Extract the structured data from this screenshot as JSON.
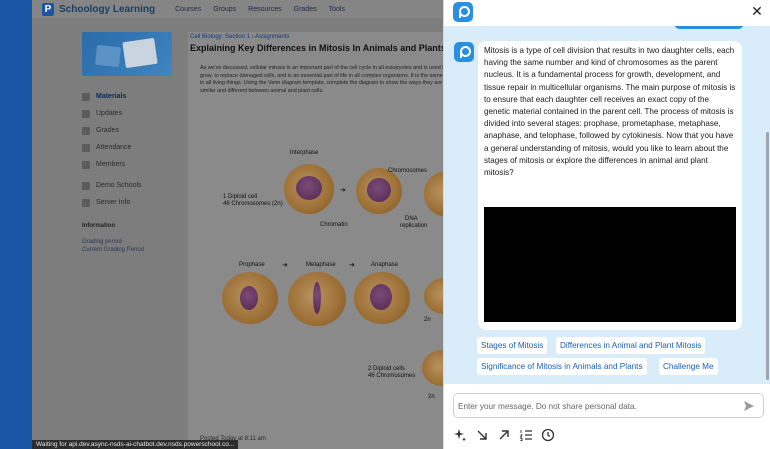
{
  "background": {
    "app_name": "Schoology Learning",
    "nav": [
      "Courses",
      "Groups",
      "Resources",
      "Grades",
      "Tools"
    ],
    "breadcrumb": [
      "Cell Biology: Section 1",
      "Assignments"
    ],
    "page_title": "Explaining Key Differences in Mitosis In Animals and Plants",
    "instructions": "As we've discussed, cellular mitosis is an important part of the cell cycle in all eukaryotes and is used to grow, to replace damaged cells, and is an essential part of life in all complex organisms. It is the same in all living things. Using the Venn diagram template, complete the diagram to show the ways they are similar and different between animal and plant cells.",
    "sidebar": [
      "Materials",
      "Updates",
      "Grades",
      "Attendance",
      "Members",
      "Demo Schools",
      "Server Info"
    ],
    "info_heading": "Information",
    "info_lines": [
      "Grading period",
      "Current Grading Period"
    ],
    "diagram_labels": {
      "interphase": "Interphase",
      "diploid_top": "1 Diploid cell",
      "chromosomes_top": "46 Chromosomes (2n)",
      "chromosomes": "Chromosomes",
      "chromatin": "Chromatin",
      "dna": "DNA",
      "replication": "replication",
      "prophase": "Prophase",
      "metaphase": "Metaphase",
      "anaphase": "Anaphase",
      "diploid_bottom": "2 Diploid cells",
      "chromosomes_bottom": "46 Chromosomes",
      "twon": "2n"
    },
    "posted": "Posted Today at 8:11 am",
    "status_bar": "Waiting for api.dev.async-nsds-ai-chatbot.dev.nsds.powerschool.co..."
  },
  "chatbot": {
    "message": "Mitosis is a type of cell division that results in two daughter cells, each having the same number and kind of chromosomes as the parent nucleus. It is a fundamental process for growth, development, and tissue repair in multicellular organisms. The main purpose of mitosis is to ensure that each daughter cell receives an exact copy of the genetic material contained in the parent cell. The process of mitosis is divided into several stages: prophase, prometaphase, metaphase, anaphase, and telophase, followed by cytokinesis. Now that you have a general understanding of mitosis, would you like to learn about the stages of mitosis or explore the differences in animal and plant mitosis?",
    "suggestions": [
      "Stages of Mitosis",
      "Differences in Animal and Plant Mitosis",
      "Significance of Mitosis in Animals and Plants",
      "Challenge Me"
    ],
    "input_placeholder": "Enter your message. Do not share personal data.",
    "icons": {
      "logo": "powerschool-logo-icon",
      "close": "close-icon",
      "send": "send-icon",
      "tools": [
        "sparkle-icon",
        "arrow-down-right-icon",
        "arrow-up-right-icon",
        "numbered-list-icon",
        "clock-icon"
      ]
    },
    "colors": {
      "accent": "#2a8fe0",
      "chat_bg": "#d8edf9",
      "chip_text": "#1b5fb4"
    }
  }
}
